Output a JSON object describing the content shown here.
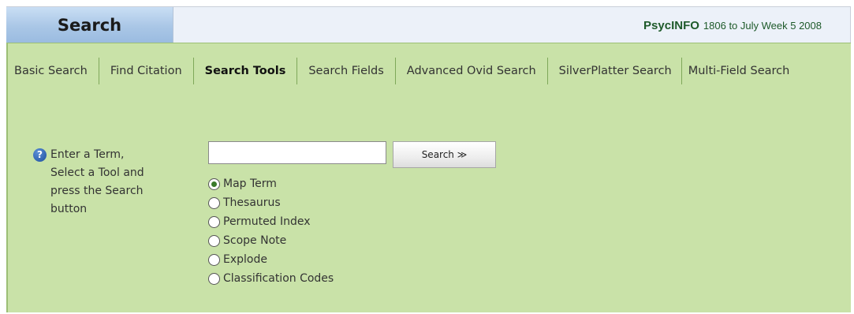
{
  "header": {
    "search_tab": "Search",
    "database_name": "PsycINFO",
    "database_range": "1806 to July Week 5 2008"
  },
  "tabs": [
    {
      "label": "Basic Search",
      "active": false
    },
    {
      "label": "Find Citation",
      "active": false
    },
    {
      "label": "Search Tools",
      "active": true
    },
    {
      "label": "Search Fields",
      "active": false
    },
    {
      "label": "Advanced Ovid Search",
      "active": false
    },
    {
      "label": "SilverPlatter Search",
      "active": false
    },
    {
      "label": "Multi-Field Search",
      "active": false
    }
  ],
  "help": {
    "icon": "help-icon",
    "text": "Enter a Term,\nSelect a Tool and\npress the Search\nbutton"
  },
  "term_input": {
    "value": "",
    "placeholder": ""
  },
  "search_button": {
    "label": "Search ≫"
  },
  "tools": [
    {
      "label": "Map Term",
      "checked": true
    },
    {
      "label": "Thesaurus",
      "checked": false
    },
    {
      "label": "Permuted Index",
      "checked": false
    },
    {
      "label": "Scope Note",
      "checked": false
    },
    {
      "label": "Explode",
      "checked": false
    },
    {
      "label": "Classification Codes",
      "checked": false
    }
  ],
  "colors": {
    "panel_bg": "#c9e2a8",
    "header_bg": "#ecf1f9",
    "db_text": "#1e5a2a",
    "selected_radio": "#3a7a2a"
  }
}
